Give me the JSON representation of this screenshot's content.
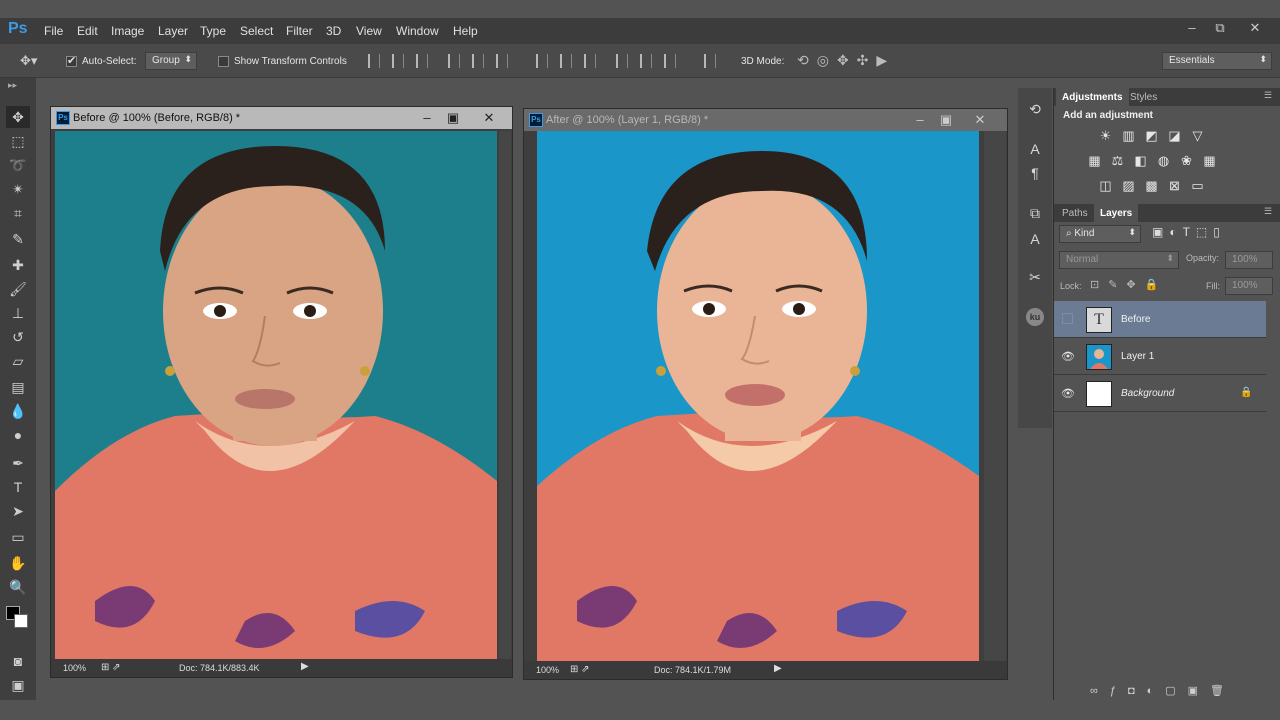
{
  "app": {
    "logo": "Ps"
  },
  "menu": [
    "File",
    "Edit",
    "Image",
    "Layer",
    "Type",
    "Select",
    "Filter",
    "3D",
    "View",
    "Window",
    "Help"
  ],
  "window_controls": {
    "minimize": "–",
    "restore": "⧉",
    "close": "✕"
  },
  "options": {
    "auto_select_label": "Auto-Select:",
    "auto_select_value": "Group",
    "show_transform_label": "Show Transform Controls",
    "mode_3d_label": "3D Mode:",
    "workspace": "Essentials"
  },
  "documents": [
    {
      "title": "Before @ 100% (Before, RGB/8) *",
      "zoom": "100%",
      "doc_info": "Doc: 784.1K/883.4K",
      "active": true
    },
    {
      "title": "After @ 100% (Layer 1, RGB/8) *",
      "zoom": "100%",
      "doc_info": "Doc: 784.1K/1.79M",
      "active": false
    }
  ],
  "panels": {
    "adjustments_tab": "Adjustments",
    "styles_tab": "Styles",
    "add_adjustment": "Add an adjustment",
    "paths_tab": "Paths",
    "layers_tab": "Layers",
    "kind": "Kind",
    "blend_mode": "Normal",
    "opacity_label": "Opacity:",
    "opacity_value": "100%",
    "lock_label": "Lock:",
    "fill_label": "Fill:",
    "fill_value": "100%"
  },
  "layers": [
    {
      "name": "Before",
      "type": "text",
      "visible": false,
      "selected": true
    },
    {
      "name": "Layer 1",
      "type": "image",
      "visible": true,
      "selected": false
    },
    {
      "name": "Background",
      "type": "fill",
      "visible": true,
      "selected": false,
      "locked": true
    }
  ],
  "colors": {
    "accent": "#3d9ae8",
    "before_background": "#1e7f8c",
    "after_background": "#1a96c9",
    "dress": "#e07865",
    "selected_layer": "#6a7b93"
  }
}
